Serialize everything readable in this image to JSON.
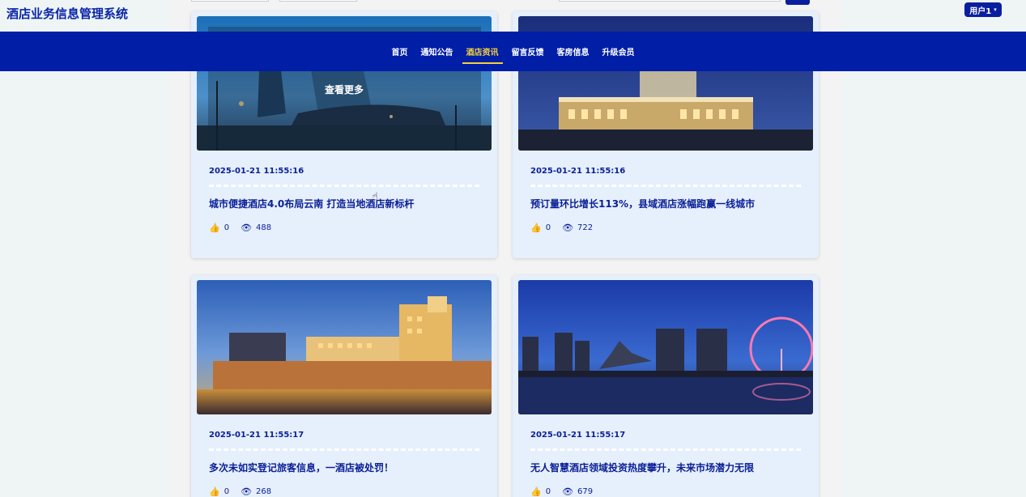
{
  "site": {
    "title": "酒店业务信息管理系统"
  },
  "user": {
    "label": "用户1"
  },
  "nav": {
    "items": [
      {
        "label": "首页",
        "active": false
      },
      {
        "label": "通知公告",
        "active": false
      },
      {
        "label": "酒店资讯",
        "active": true
      },
      {
        "label": "留言反馈",
        "active": false
      },
      {
        "label": "客房信息",
        "active": false
      },
      {
        "label": "升级会员",
        "active": false
      }
    ]
  },
  "colors": {
    "navbar": "#001ea6",
    "active_nav": "#f5d23b",
    "card_bg": "#e6effc",
    "text_primary": "#0a1f96"
  },
  "news": [
    {
      "date": "2025-01-21 11:55:16",
      "title": "城市便捷酒店4.0布局云南 打造当地酒店新标杆",
      "likes": "0",
      "views": "488",
      "hover_label": "查看更多",
      "image_icon": "hotel-tower-night-image"
    },
    {
      "date": "2025-01-21 11:55:16",
      "title": "预订量环比增长113%，县域酒店涨幅跑赢一线城市",
      "likes": "0",
      "views": "722",
      "image_icon": "hotel-building-night-image"
    },
    {
      "date": "2025-01-21 11:55:17",
      "title": "多次未如实登记旅客信息，一酒店被处罚！",
      "likes": "0",
      "views": "268",
      "image_icon": "casino-hotel-waterfront-image"
    },
    {
      "date": "2025-01-21 11:55:17",
      "title": "无人智慧酒店领域投资热度攀升，未来市场潜力无限",
      "likes": "0",
      "views": "679",
      "image_icon": "city-skyline-ferris-wheel-image"
    }
  ]
}
